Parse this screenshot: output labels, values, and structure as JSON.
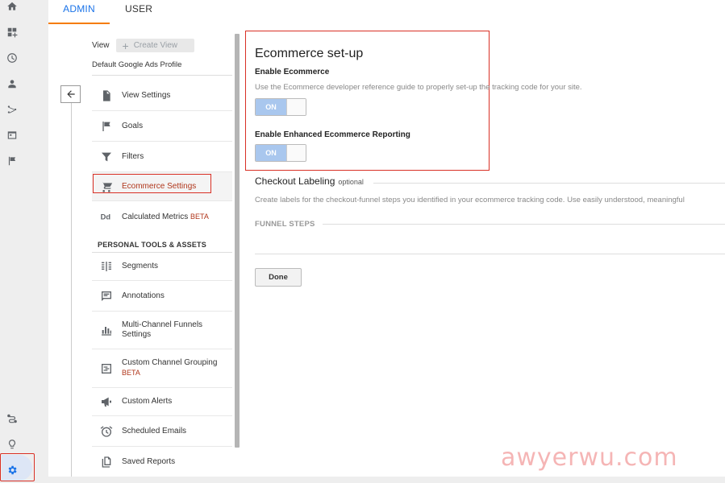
{
  "tabs": {
    "admin": "ADMIN",
    "user": "USER"
  },
  "nav": {
    "view_label": "View",
    "create_view": "Create View",
    "profile": "Default Google Ads Profile",
    "items": [
      {
        "label": "View Settings"
      },
      {
        "label": "Goals"
      },
      {
        "label": "Filters"
      },
      {
        "label": "Ecommerce Settings"
      },
      {
        "label": "Calculated Metrics",
        "badge": "BETA"
      }
    ],
    "section_title": "PERSONAL TOOLS & ASSETS",
    "tools": [
      {
        "label": "Segments"
      },
      {
        "label": "Annotations"
      },
      {
        "label": "Multi-Channel Funnels Settings"
      },
      {
        "label": "Custom Channel Grouping",
        "badge": "BETA"
      },
      {
        "label": "Custom Alerts"
      },
      {
        "label": "Scheduled Emails"
      },
      {
        "label": "Saved Reports"
      }
    ]
  },
  "content": {
    "title": "Ecommerce set-up",
    "enable_ecommerce": "Enable Ecommerce",
    "enable_ecommerce_desc": "Use the Ecommerce developer reference guide to properly set-up the tracking code for your site.",
    "toggle_on": "ON",
    "enhanced_title": "Enable Enhanced Ecommerce Reporting",
    "checkout_title": "Checkout Labeling",
    "checkout_optional": "optional",
    "checkout_desc": "Create labels for the checkout-funnel steps you identified in your ecommerce tracking code. Use easily understood, meaningful",
    "funnel_steps": "FUNNEL STEPS",
    "done": "Done"
  },
  "watermark": "awyerwu.com",
  "colors": {
    "accent": "#1a73e8",
    "tab_underline": "#f57c00",
    "highlight": "#d93025",
    "toggle_on": "#a9c7ee",
    "beta": "#b0361b"
  }
}
